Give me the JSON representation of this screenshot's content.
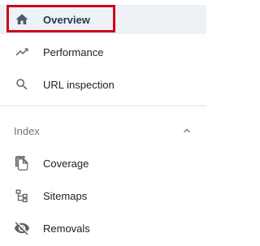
{
  "nav": {
    "items": [
      {
        "label": "Overview",
        "icon": "home-icon",
        "active": true
      },
      {
        "label": "Performance",
        "icon": "trending-up-icon"
      },
      {
        "label": "URL inspection",
        "icon": "search-icon"
      }
    ]
  },
  "index_section": {
    "header": "Index",
    "expanded": true,
    "items": [
      {
        "label": "Coverage",
        "icon": "file-copy-icon"
      },
      {
        "label": "Sitemaps",
        "icon": "sitemap-icon"
      },
      {
        "label": "Removals",
        "icon": "visibility-off-icon"
      }
    ]
  },
  "colors": {
    "active_bg": "#eef2f6",
    "highlight": "#d0021b",
    "icon": "#5f6368"
  }
}
